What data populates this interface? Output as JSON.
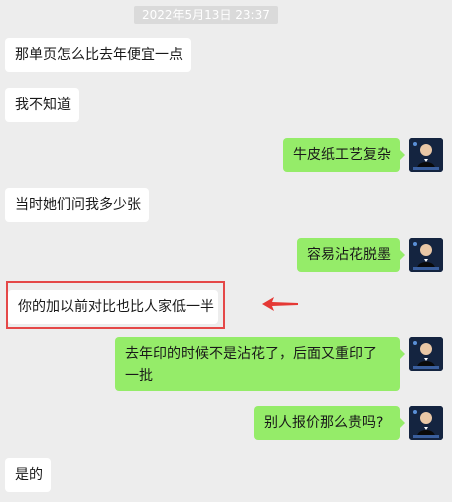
{
  "timestamp": "2022年5月13日 23:37",
  "colors": {
    "background": "#ededed",
    "incoming_bubble": "#ffffff",
    "outgoing_bubble": "#95ec69",
    "highlight": "#e54848",
    "arrow": "#e53935"
  },
  "messages": [
    {
      "side": "left",
      "text": "那单页怎么比去年便宜一点"
    },
    {
      "side": "left",
      "text": "我不知道"
    },
    {
      "side": "right",
      "text": "牛皮纸工艺复杂"
    },
    {
      "side": "left",
      "text": "当时她们问我多少张"
    },
    {
      "side": "right",
      "text": "容易沾花脱墨"
    },
    {
      "side": "left",
      "text": "你的加以前对比也比人家低一半",
      "highlighted": true
    },
    {
      "side": "right",
      "text": "去年印的时候不是沾花了，后面又重印了一批"
    },
    {
      "side": "right",
      "text": "别人报价那么贵吗?"
    },
    {
      "side": "left",
      "text": "是的"
    }
  ],
  "annotation": {
    "arrow_icon": "red-arrow-left-icon",
    "box_icon": "red-highlight-box"
  }
}
